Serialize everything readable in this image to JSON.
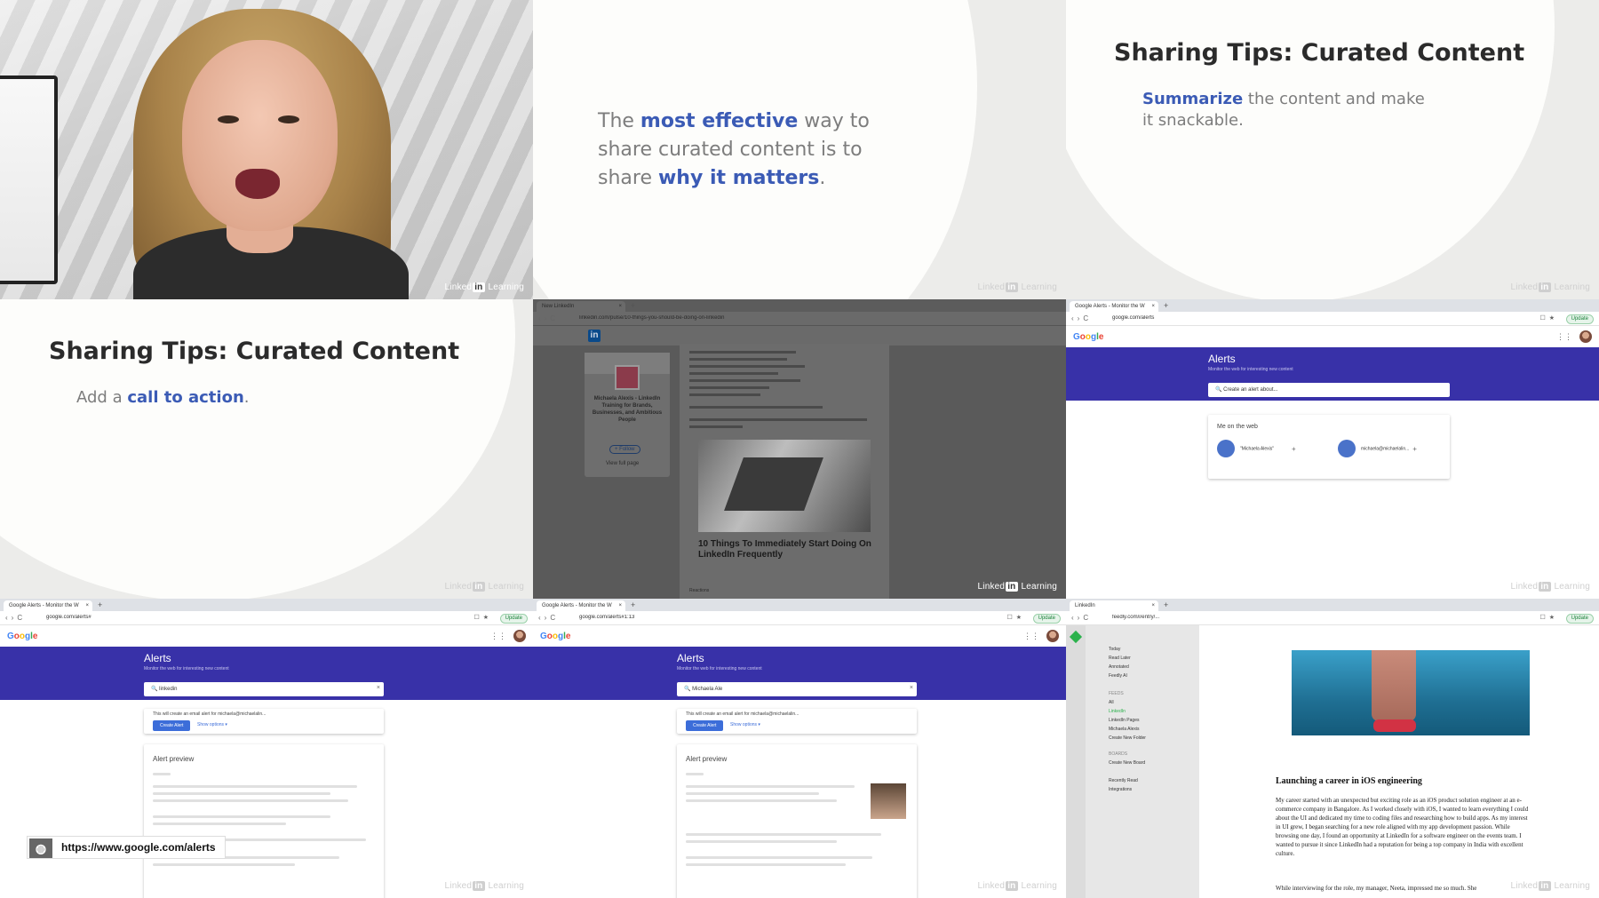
{
  "watermark": {
    "pre": "Linked",
    "in": "in",
    "post": " Learning"
  },
  "slide1": {
    "t1": "The ",
    "b1": "most effective",
    "t2": " way to",
    "t3": "share curated content is to",
    "t4": "share ",
    "b2": "why it matters",
    "t5": "."
  },
  "slide2": {
    "title": "Sharing Tips: Curated Content",
    "bold": "Summarize",
    "rest1": " the content and make",
    "rest2": "it snackable."
  },
  "slide3": {
    "title": "Sharing Tips: Curated Content",
    "pre": "Add a ",
    "bold": "call to action",
    "post": "."
  },
  "linkedin": {
    "profile_name": "Michaela Alexis - LinkedIn Training for Brands, Businesses, and Ambitious People",
    "follow": "+ Follow",
    "view_full_page": "View full page",
    "article_title": "10 Things To Immediately Start Doing On LinkedIn Frequently",
    "reactions": "Reactions"
  },
  "alerts_home": {
    "tab": "Google Alerts - Monitor the W",
    "url": "google.com/alerts",
    "title": "Alerts",
    "subtitle": "Monitor the web for interesting new content",
    "search_placeholder": "Create an alert about...",
    "card_title": "Me on the web",
    "chip1": "\"Michaela Alexis\"",
    "chip2": "michaela@michaelalin..."
  },
  "alerts_typing1": {
    "tab": "Google Alerts - Monitor the W",
    "url": "google.com/alerts#",
    "title": "Alerts",
    "subtitle": "Monitor the web for interesting new content",
    "query": "linkedin",
    "note": "This will create an email alert for michaela@michaelalin...",
    "create": "Create Alert",
    "show_options": "Show options ▾",
    "preview": "Alert preview"
  },
  "alerts_typing2": {
    "tab": "Google Alerts - Monitor the W",
    "url": "google.com/alerts#1:13",
    "title": "Alerts",
    "subtitle": "Monitor the web for interesting new content",
    "query": "Michaela Ale",
    "note": "This will create an email alert for michaela@michaelalin...",
    "create": "Create Alert",
    "show_options": "Show options ▾",
    "preview": "Alert preview"
  },
  "linkedin_tab": {
    "tab": "New LinkedIn",
    "url": "linkedin.com/pulse/10-things-you-should-be-doing-on-linkedin"
  },
  "feedly": {
    "tab": "LinkedIn",
    "url": "feedly.com/i/entry/...",
    "nav": [
      "Today",
      "Read Later",
      "Annotated",
      "Feedly AI"
    ],
    "feeds_label": "FEEDS",
    "feeds": [
      "All",
      "LinkedIn",
      "LinkedIn Pages",
      "Michaela Alexis",
      "Create New Folder"
    ],
    "boards_label": "BOARDS",
    "boards": [
      "Create New Board"
    ],
    "bottom": [
      "Recently Read",
      "Integrations"
    ],
    "article_title": "Launching a career in iOS engineering",
    "article_body": "My career started with an unexpected but exciting role as an iOS product solution engineer at an e-commerce company in Bangalore. As I worked closely with iOS, I wanted to learn everything I could about the UI and dedicated my time to coding files and researching how to build apps. As my interest in UI grew, I began searching for a new role aligned with my app development passion. While browsing one day, I found an opportunity at LinkedIn for a software engineer on the events team. I wanted to pursue it since LinkedIn had a reputation for being a top company in India with excellent culture.",
    "article_more": "While interviewing for the role, my manager, Neeta, impressed me so much. She"
  },
  "url_tooltip": "https://www.google.com/alerts"
}
